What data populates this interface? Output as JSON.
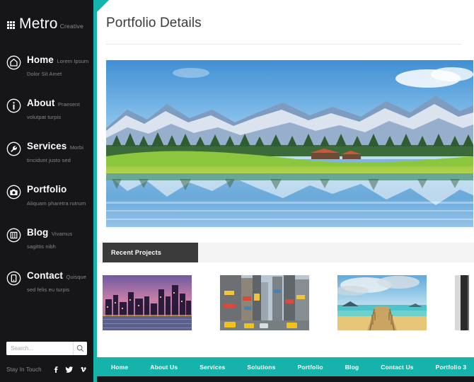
{
  "sidebar": {
    "brand": {
      "name": "Metro",
      "tagline": "Creative",
      "icon": "grid-icon"
    },
    "items": [
      {
        "label": "Home",
        "desc": "Lorem Ipsum Dolor Sit Amet",
        "icon": "home-icon"
      },
      {
        "label": "About",
        "desc": "Praesent volutpat turpis",
        "icon": "info-icon"
      },
      {
        "label": "Services",
        "desc": "Morbi tincidunt justo sed",
        "icon": "wrench-icon"
      },
      {
        "label": "Portfolio",
        "desc": "Aliquam pharetra rutrum",
        "icon": "camera-icon"
      },
      {
        "label": "Blog",
        "desc": "Vivamus sagittis nibh",
        "icon": "list-icon"
      },
      {
        "label": "Contact",
        "desc": "Quisque sed felis eu turpis",
        "icon": "phone-icon"
      }
    ],
    "search": {
      "placeholder": "Search...",
      "value": "",
      "icon": "search-icon"
    },
    "social": {
      "label": "Stay In Touch",
      "links": [
        {
          "name": "facebook-icon",
          "glyph": "f"
        },
        {
          "name": "twitter-icon",
          "glyph": "t"
        },
        {
          "name": "vimeo-icon",
          "glyph": "v"
        }
      ]
    }
  },
  "main": {
    "page_title": "Portfolio Details",
    "hero_alt": "Alpine lake with snowy mountains and green meadow reflected in still water",
    "recent_projects_label": "Recent Projects",
    "thumbnails": [
      {
        "alt": "City skyline at dusk with purple sky"
      },
      {
        "alt": "Times Square street with yellow taxis"
      },
      {
        "alt": "Wooden pier over turquoise beach water"
      },
      {
        "alt": "Partially visible fourth project"
      }
    ]
  },
  "footer": {
    "nav": [
      {
        "label": "Home"
      },
      {
        "label": "About Us"
      },
      {
        "label": "Services"
      },
      {
        "label": "Solutions"
      },
      {
        "label": "Portfolio"
      },
      {
        "label": "Blog"
      },
      {
        "label": "Contact Us"
      },
      {
        "label": "Portfolio 3"
      }
    ]
  },
  "colors": {
    "accent_teal": "#16b3aa",
    "sidebar_dark": "#161619",
    "tab_dark": "#3b3b3b",
    "band_gray": "#f4f4f4"
  }
}
